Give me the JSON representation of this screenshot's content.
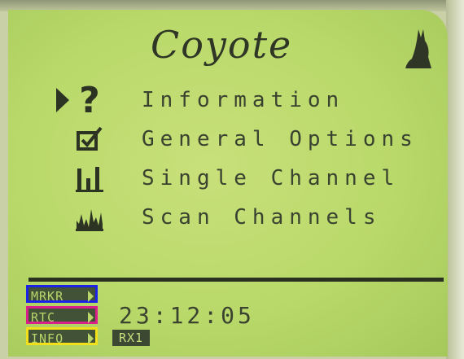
{
  "header": {
    "title": "Coyote",
    "logo_icon": "coyote-icon"
  },
  "menu": {
    "items": [
      {
        "label": "Information",
        "icon": "question-icon",
        "selected": true
      },
      {
        "label": "General Options",
        "icon": "checkbox-icon",
        "selected": false
      },
      {
        "label": "Single Channel",
        "icon": "bar-chart-icon",
        "selected": false
      },
      {
        "label": "Scan Channels",
        "icon": "spectrum-icon",
        "selected": false
      }
    ]
  },
  "status": {
    "soft_keys": {
      "marker": "MRKR",
      "rtc": "RTC",
      "info": "INFO"
    },
    "time": "23:12:05",
    "receiver": "RX1"
  },
  "colors": {
    "screen": "#b9d96a",
    "ink": "#2f3626",
    "marker_outline": "#1a23e6",
    "rtc_outline": "#d81f8a",
    "info_outline": "#f2e01a"
  }
}
